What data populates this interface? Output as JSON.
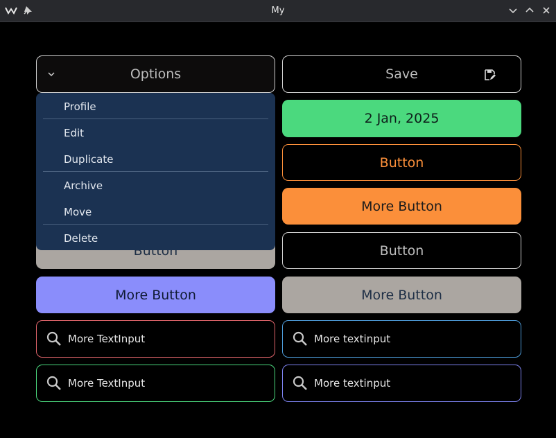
{
  "window": {
    "title": "My"
  },
  "dropdown": {
    "label": "Options",
    "items": [
      "Profile",
      "Edit",
      "Duplicate",
      "Archive",
      "Move",
      "Delete"
    ]
  },
  "left": {
    "button_gray_label": "Button",
    "button_blue_label": "More Button"
  },
  "right": {
    "save_label": "Save",
    "date_label": "2 Jan, 2025",
    "orange_outline_label": "Button",
    "orange_filled_label": "More Button",
    "outline_label": "Button",
    "gray_label": "More Button"
  },
  "inputs": {
    "red_value": "More TextInput",
    "green_value": "More TextInput",
    "blue_value": "More textinput",
    "indigo_value": "More textinput"
  },
  "colors": {
    "green": "#4bd97e",
    "orange": "#fb8f3a",
    "blue": "#8a8dfb",
    "gray": "#aba6a1",
    "menu_bg": "#1b3252"
  }
}
